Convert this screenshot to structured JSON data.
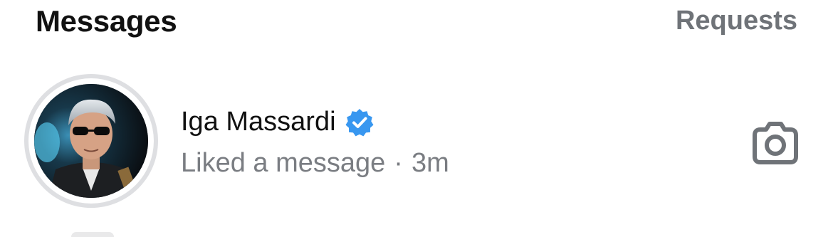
{
  "header": {
    "title": "Messages",
    "requests_label": "Requests"
  },
  "thread": {
    "name": "Iga Massardi",
    "verified": true,
    "activity": "Liked a message",
    "separator": "·",
    "time": "3m",
    "action_icon": "camera-icon",
    "avatar_icon": "profile-photo"
  },
  "colors": {
    "verified": "#3897f0",
    "secondary_text": "#7a7d82",
    "ring": "#dedfe2"
  }
}
